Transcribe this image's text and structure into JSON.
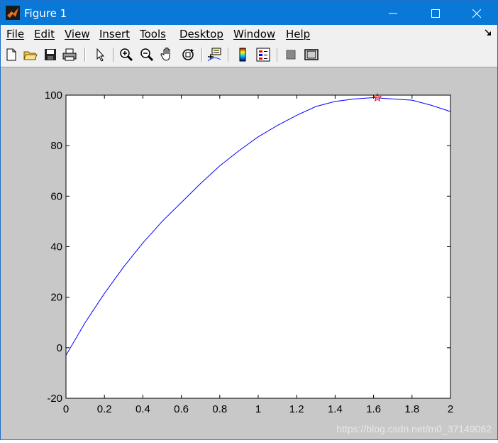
{
  "window": {
    "title": "Figure 1",
    "controls": {
      "minimize": "—",
      "maximize": "☐",
      "close": "✕"
    }
  },
  "menubar": {
    "items": [
      "File",
      "Edit",
      "View",
      "Insert",
      "Tools",
      "Desktop",
      "Window",
      "Help"
    ],
    "dock_icon": "dock-arrow-icon"
  },
  "toolbar": {
    "buttons": [
      "new-figure-icon",
      "open-file-icon",
      "save-icon",
      "print-icon",
      "edit-plot-arrow-icon",
      "zoom-in-icon",
      "zoom-out-icon",
      "pan-hand-icon",
      "rotate-3d-icon",
      "data-cursor-icon",
      "colorbar-icon",
      "legend-icon",
      "hide-plot-tools-icon",
      "show-plot-tools-icon"
    ]
  },
  "chart_data": {
    "type": "line",
    "title": "",
    "xlabel": "",
    "ylabel": "",
    "xlim": [
      0,
      2
    ],
    "ylim": [
      -20,
      100
    ],
    "xticks": [
      "0",
      "0.2",
      "0.4",
      "0.6",
      "0.8",
      "1",
      "1.2",
      "1.4",
      "1.6",
      "1.8",
      "2"
    ],
    "yticks": [
      "-20",
      "0",
      "20",
      "40",
      "60",
      "80",
      "100"
    ],
    "grid": false,
    "series": [
      {
        "color": "#0000ff",
        "x": [
          0,
          0.1,
          0.2,
          0.3,
          0.4,
          0.5,
          0.6,
          0.7,
          0.8,
          0.9,
          1.0,
          1.1,
          1.2,
          1.3,
          1.4,
          1.5,
          1.6,
          1.7,
          1.8,
          1.9,
          2.0
        ],
        "y": [
          -3,
          10,
          21.5,
          32,
          41.5,
          50,
          57.5,
          65,
          72,
          78,
          83.5,
          88,
          92,
          95.5,
          97.5,
          98.5,
          99,
          98.5,
          98,
          96,
          93.5
        ]
      },
      {
        "type": "scatter",
        "marker": "star",
        "color": "#ff0000",
        "x": [
          1.62
        ],
        "y": [
          99
        ]
      }
    ]
  },
  "watermark": "https://blog.csdn.net/m0_37149062"
}
